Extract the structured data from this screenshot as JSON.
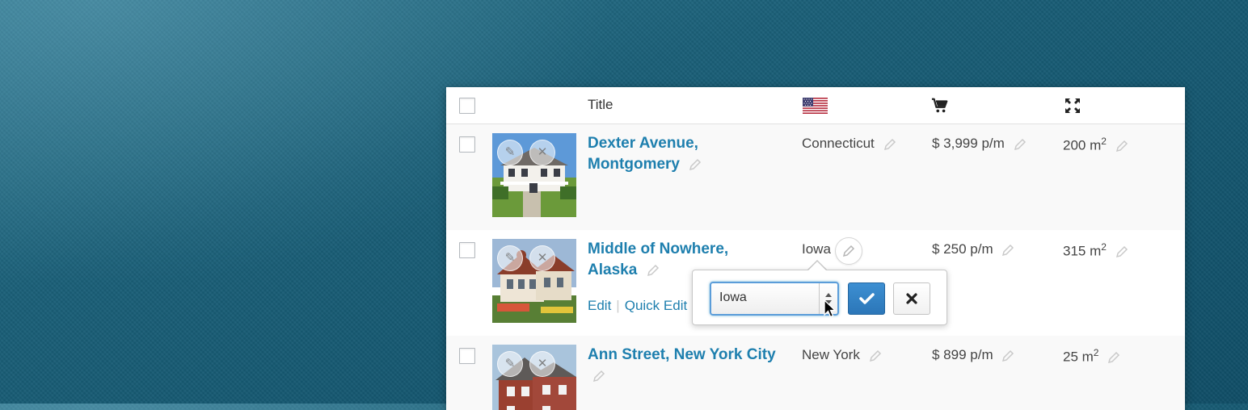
{
  "header": {
    "title": "Title",
    "flag_icon": "us-flag-icon",
    "price_icon": "cart-icon",
    "size_icon": "expand-icon"
  },
  "rows": [
    {
      "title_line1": "Dexter Avenue,",
      "title_line2": "Montgomery",
      "state": "Connecticut",
      "price": "$ 3,999 p/m",
      "size": "200 m",
      "size_sup": "2"
    },
    {
      "title_line1": "Middle of Nowhere,",
      "title_line2": "Alaska",
      "state": "Iowa",
      "price": "$ 250 p/m",
      "size": "315 m",
      "size_sup": "2",
      "actions": {
        "edit": "Edit",
        "separator": "|",
        "quick_edit": "Quick Edit"
      }
    },
    {
      "title_line1": "Ann Street, New York City",
      "state": "New York",
      "price": "$ 899 p/m",
      "size": "25 m",
      "size_sup": "2"
    }
  ],
  "popover": {
    "select_value": "Iowa"
  },
  "colors": {
    "link": "#1e7fae",
    "confirm_button": "#2f80c4",
    "background": "#17586f"
  }
}
